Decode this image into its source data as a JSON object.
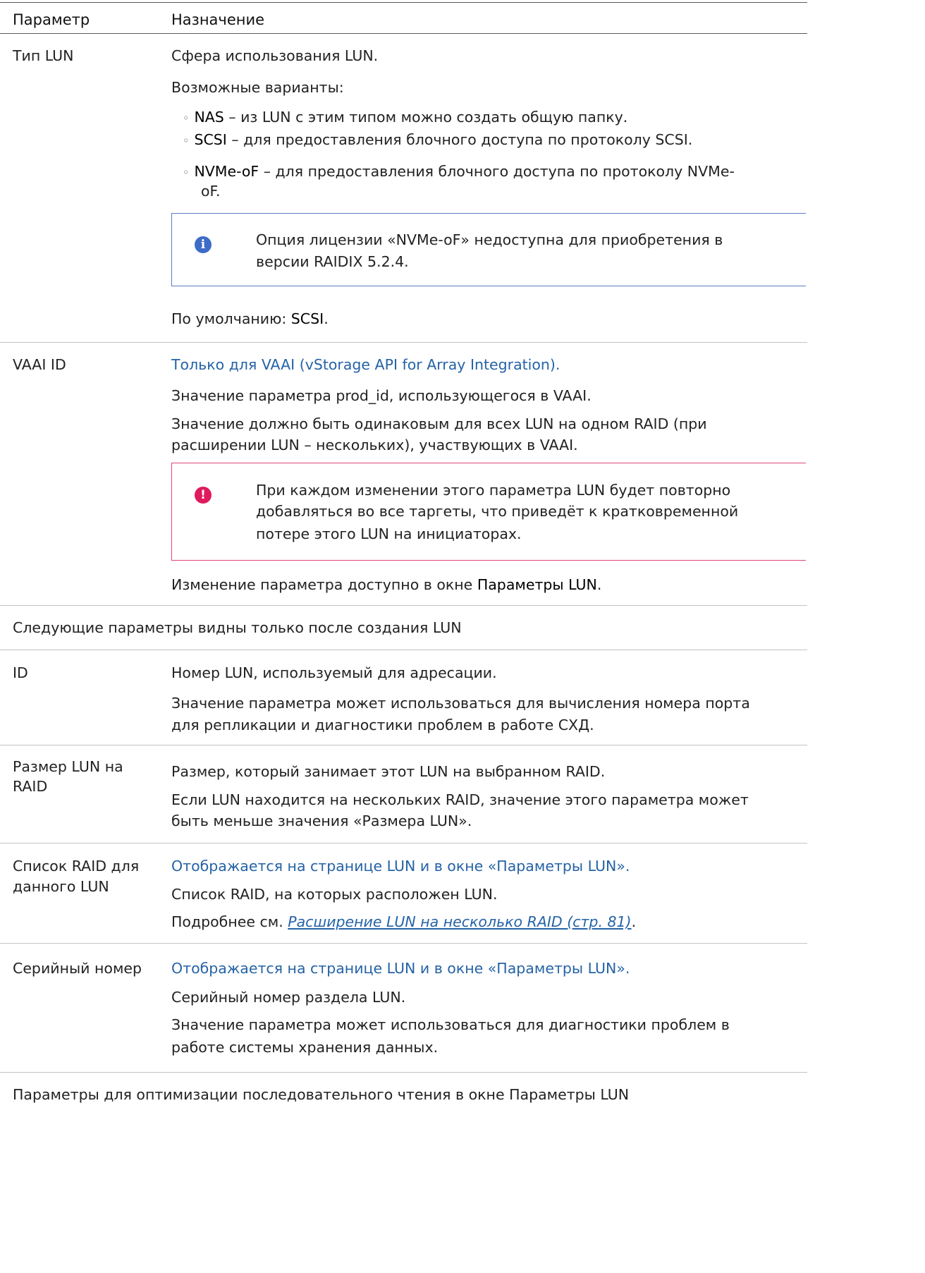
{
  "header": {
    "param": "Параметр",
    "purpose": "Назначение"
  },
  "rows": {
    "lun_type": {
      "name": "Тип LUN",
      "line1": "Сфера использования LUN.",
      "line2": "Возможные варианты:",
      "opt1": {
        "label": "NAS",
        "text": " – из LUN с этим типом можно создать общую папку."
      },
      "opt2": {
        "label": "SCSI",
        "text": " – для предоставления блочного доступа по протоколу SCSI."
      },
      "opt3": {
        "label": "NVMe-oF",
        "text": " – для предоставления блочного доступа по протоколу NVMe-",
        "cont": "oF."
      },
      "info_icon": "info-icon",
      "info_line1": "Опция лицензии «NVMe-oF» недоступна для приобретения в",
      "info_line2": "версии RAIDIX 5.2.4.",
      "default_prefix": "По умолчанию: ",
      "default_value": "SCSI",
      "default_suffix": "."
    },
    "vaai": {
      "name": "VAAI ID",
      "note": "Только для VAAI (vStorage API for Array Integration).",
      "line1": "Значение параметра prod_id, использующегося в VAAI.",
      "line2a": "Значение должно быть одинаковым для всех LUN на одном RAID (при",
      "line2b": "расширении LUN – нескольких), участвующих в VAAI.",
      "warn_icon": "exclamation-icon",
      "warn_line1": "При каждом изменении этого параметра LUN будет повторно",
      "warn_line2": "добавляться во все таргеты, что приведёт к кратковременной",
      "warn_line3": "потере этого LUN на инициаторах.",
      "change_prefix": "Изменение параметра доступно в окне ",
      "change_value": "Параметры LUN",
      "change_suffix": "."
    },
    "section1": "Следующие параметры видны только после создания LUN",
    "id": {
      "name": "ID",
      "line1": "Номер LUN, используемый для адресации.",
      "line2a": "Значение параметра может использоваться для вычисления номера порта",
      "line2b": "для репликации и диагностики проблем в работе СХД."
    },
    "size": {
      "name1": "Размер LUN на",
      "name2": "RAID",
      "line1": "Размер, который занимает этот LUN на выбранном RAID.",
      "line2a": "Если LUN находится на нескольких RAID, значение этого параметра может",
      "line2b": "быть меньше значения «Размера LUN»."
    },
    "raid_list": {
      "name1": "Список RAID для",
      "name2": "данного LUN",
      "note": "Отображается на странице LUN и в окне «Параметры LUN».",
      "line1": "Список RAID, на которых расположен LUN.",
      "more_prefix": "Подробнее см. ",
      "more_link": "Расширение LUN на несколько RAID (стр. 81)",
      "more_suffix": "."
    },
    "serial": {
      "name": "Серийный номер",
      "note": "Отображается на странице LUN и в окне «Параметры LUN».",
      "line1": "Серийный номер раздела LUN.",
      "line2a": "Значение параметра может использоваться для диагностики проблем в",
      "line2b": "работе системы хранения данных."
    },
    "section2": "Параметры для оптимизации последовательного чтения в окне Параметры LUN"
  }
}
